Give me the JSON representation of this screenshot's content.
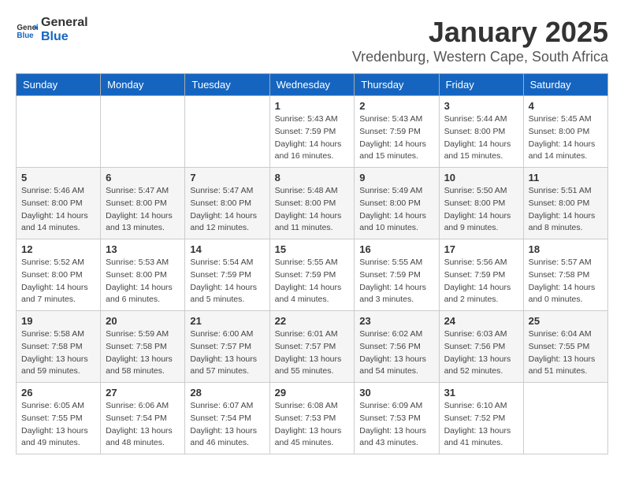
{
  "header": {
    "logo_general": "General",
    "logo_blue": "Blue",
    "month": "January 2025",
    "location": "Vredenburg, Western Cape, South Africa"
  },
  "days_of_week": [
    "Sunday",
    "Monday",
    "Tuesday",
    "Wednesday",
    "Thursday",
    "Friday",
    "Saturday"
  ],
  "weeks": [
    [
      {
        "day": "",
        "detail": ""
      },
      {
        "day": "",
        "detail": ""
      },
      {
        "day": "",
        "detail": ""
      },
      {
        "day": "1",
        "detail": "Sunrise: 5:43 AM\nSunset: 7:59 PM\nDaylight: 14 hours\nand 16 minutes."
      },
      {
        "day": "2",
        "detail": "Sunrise: 5:43 AM\nSunset: 7:59 PM\nDaylight: 14 hours\nand 15 minutes."
      },
      {
        "day": "3",
        "detail": "Sunrise: 5:44 AM\nSunset: 8:00 PM\nDaylight: 14 hours\nand 15 minutes."
      },
      {
        "day": "4",
        "detail": "Sunrise: 5:45 AM\nSunset: 8:00 PM\nDaylight: 14 hours\nand 14 minutes."
      }
    ],
    [
      {
        "day": "5",
        "detail": "Sunrise: 5:46 AM\nSunset: 8:00 PM\nDaylight: 14 hours\nand 14 minutes."
      },
      {
        "day": "6",
        "detail": "Sunrise: 5:47 AM\nSunset: 8:00 PM\nDaylight: 14 hours\nand 13 minutes."
      },
      {
        "day": "7",
        "detail": "Sunrise: 5:47 AM\nSunset: 8:00 PM\nDaylight: 14 hours\nand 12 minutes."
      },
      {
        "day": "8",
        "detail": "Sunrise: 5:48 AM\nSunset: 8:00 PM\nDaylight: 14 hours\nand 11 minutes."
      },
      {
        "day": "9",
        "detail": "Sunrise: 5:49 AM\nSunset: 8:00 PM\nDaylight: 14 hours\nand 10 minutes."
      },
      {
        "day": "10",
        "detail": "Sunrise: 5:50 AM\nSunset: 8:00 PM\nDaylight: 14 hours\nand 9 minutes."
      },
      {
        "day": "11",
        "detail": "Sunrise: 5:51 AM\nSunset: 8:00 PM\nDaylight: 14 hours\nand 8 minutes."
      }
    ],
    [
      {
        "day": "12",
        "detail": "Sunrise: 5:52 AM\nSunset: 8:00 PM\nDaylight: 14 hours\nand 7 minutes."
      },
      {
        "day": "13",
        "detail": "Sunrise: 5:53 AM\nSunset: 8:00 PM\nDaylight: 14 hours\nand 6 minutes."
      },
      {
        "day": "14",
        "detail": "Sunrise: 5:54 AM\nSunset: 7:59 PM\nDaylight: 14 hours\nand 5 minutes."
      },
      {
        "day": "15",
        "detail": "Sunrise: 5:55 AM\nSunset: 7:59 PM\nDaylight: 14 hours\nand 4 minutes."
      },
      {
        "day": "16",
        "detail": "Sunrise: 5:55 AM\nSunset: 7:59 PM\nDaylight: 14 hours\nand 3 minutes."
      },
      {
        "day": "17",
        "detail": "Sunrise: 5:56 AM\nSunset: 7:59 PM\nDaylight: 14 hours\nand 2 minutes."
      },
      {
        "day": "18",
        "detail": "Sunrise: 5:57 AM\nSunset: 7:58 PM\nDaylight: 14 hours\nand 0 minutes."
      }
    ],
    [
      {
        "day": "19",
        "detail": "Sunrise: 5:58 AM\nSunset: 7:58 PM\nDaylight: 13 hours\nand 59 minutes."
      },
      {
        "day": "20",
        "detail": "Sunrise: 5:59 AM\nSunset: 7:58 PM\nDaylight: 13 hours\nand 58 minutes."
      },
      {
        "day": "21",
        "detail": "Sunrise: 6:00 AM\nSunset: 7:57 PM\nDaylight: 13 hours\nand 57 minutes."
      },
      {
        "day": "22",
        "detail": "Sunrise: 6:01 AM\nSunset: 7:57 PM\nDaylight: 13 hours\nand 55 minutes."
      },
      {
        "day": "23",
        "detail": "Sunrise: 6:02 AM\nSunset: 7:56 PM\nDaylight: 13 hours\nand 54 minutes."
      },
      {
        "day": "24",
        "detail": "Sunrise: 6:03 AM\nSunset: 7:56 PM\nDaylight: 13 hours\nand 52 minutes."
      },
      {
        "day": "25",
        "detail": "Sunrise: 6:04 AM\nSunset: 7:55 PM\nDaylight: 13 hours\nand 51 minutes."
      }
    ],
    [
      {
        "day": "26",
        "detail": "Sunrise: 6:05 AM\nSunset: 7:55 PM\nDaylight: 13 hours\nand 49 minutes."
      },
      {
        "day": "27",
        "detail": "Sunrise: 6:06 AM\nSunset: 7:54 PM\nDaylight: 13 hours\nand 48 minutes."
      },
      {
        "day": "28",
        "detail": "Sunrise: 6:07 AM\nSunset: 7:54 PM\nDaylight: 13 hours\nand 46 minutes."
      },
      {
        "day": "29",
        "detail": "Sunrise: 6:08 AM\nSunset: 7:53 PM\nDaylight: 13 hours\nand 45 minutes."
      },
      {
        "day": "30",
        "detail": "Sunrise: 6:09 AM\nSunset: 7:53 PM\nDaylight: 13 hours\nand 43 minutes."
      },
      {
        "day": "31",
        "detail": "Sunrise: 6:10 AM\nSunset: 7:52 PM\nDaylight: 13 hours\nand 41 minutes."
      },
      {
        "day": "",
        "detail": ""
      }
    ]
  ]
}
